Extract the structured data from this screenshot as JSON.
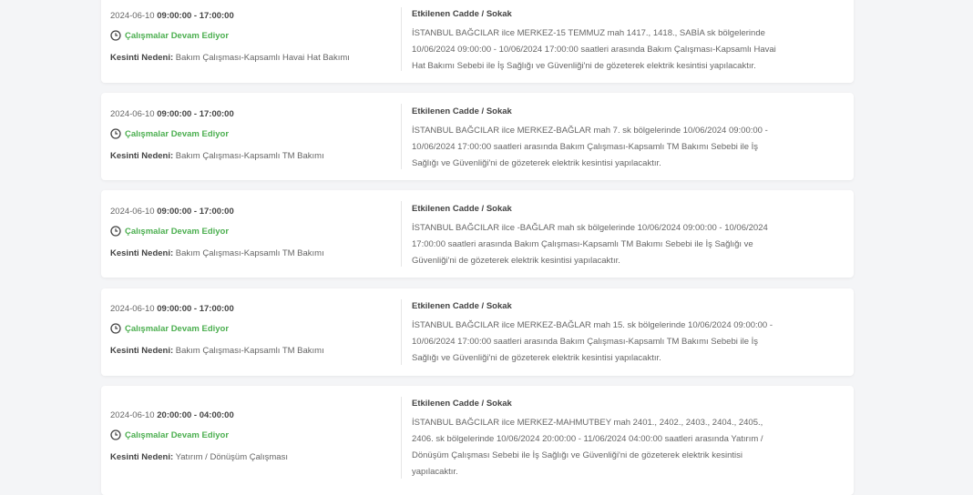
{
  "labels": {
    "affected": "Etkilenen Cadde / Sokak",
    "reason_label": "Kesinti Nedeni:",
    "status": "Çalışmalar Devam Ediyor"
  },
  "colors": {
    "status": "#4caf50",
    "card_bg": "#ffffff",
    "page_bg": "#f4f5f7"
  },
  "icons": {
    "status_icon": "clock-icon"
  },
  "outages": [
    {
      "date": "2024-06-10",
      "time": "09:00:00 - 17:00:00",
      "reason": "Bakım Çalışması-Kapsamlı Havai Hat Bakımı",
      "description": "İSTANBUL BAĞCILAR ilce MERKEZ-15 TEMMUZ mah 1417., 1418., SABİA sk bölgelerinde 10/06/2024 09:00:00 - 10/06/2024 17:00:00 saatleri arasında Bakım Çalışması-Kapsamlı Havai Hat Bakımı Sebebi ile İş Sağlığı ve Güvenliği'ni de gözeterek elektrik kesintisi yapılacaktır."
    },
    {
      "date": "2024-06-10",
      "time": "09:00:00 - 17:00:00",
      "reason": "Bakım Çalışması-Kapsamlı TM Bakımı",
      "description": "İSTANBUL BAĞCILAR ilce MERKEZ-BAĞLAR mah 7. sk bölgelerinde 10/06/2024 09:00:00 - 10/06/2024 17:00:00 saatleri arasında Bakım Çalışması-Kapsamlı TM Bakımı Sebebi ile İş Sağlığı ve Güvenliği'ni de gözeterek elektrik kesintisi yapılacaktır."
    },
    {
      "date": "2024-06-10",
      "time": "09:00:00 - 17:00:00",
      "reason": "Bakım Çalışması-Kapsamlı TM Bakımı",
      "description": "İSTANBUL BAĞCILAR ilce -BAĞLAR mah sk bölgelerinde 10/06/2024 09:00:00 - 10/06/2024 17:00:00 saatleri arasında Bakım Çalışması-Kapsamlı TM Bakımı Sebebi ile İş Sağlığı ve Güvenliği'ni de gözeterek elektrik kesintisi yapılacaktır."
    },
    {
      "date": "2024-06-10",
      "time": "09:00:00 - 17:00:00",
      "reason": "Bakım Çalışması-Kapsamlı TM Bakımı",
      "description": "İSTANBUL BAĞCILAR ilce MERKEZ-BAĞLAR mah 15. sk bölgelerinde 10/06/2024 09:00:00 - 10/06/2024 17:00:00 saatleri arasında Bakım Çalışması-Kapsamlı TM Bakımı Sebebi ile İş Sağlığı ve Güvenliği'ni de gözeterek elektrik kesintisi yapılacaktır."
    },
    {
      "date": "2024-06-10",
      "time": "20:00:00 - 04:00:00",
      "reason": "Yatırım / Dönüşüm Çalışması",
      "description": "İSTANBUL BAĞCILAR ilce MERKEZ-MAHMUTBEY mah 2401., 2402., 2403., 2404., 2405., 2406. sk bölgelerinde 10/06/2024 20:00:00 - 11/06/2024 04:00:00 saatleri arasında Yatırım / Dönüşüm Çalışması Sebebi ile İş Sağlığı ve Güvenliği'ni de gözeterek elektrik kesintisi yapılacaktır."
    }
  ]
}
